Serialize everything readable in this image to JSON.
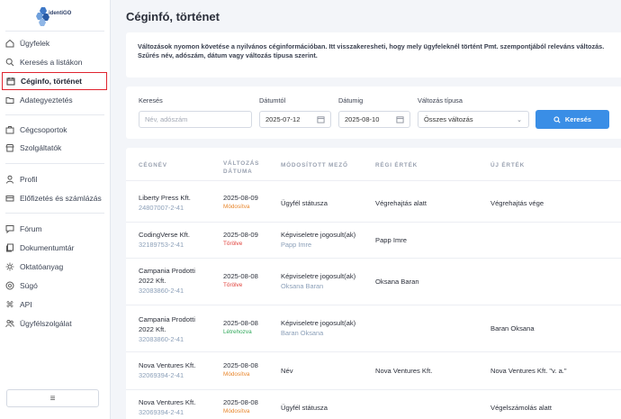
{
  "brand": {
    "logo_text": "identiGO"
  },
  "sidebar": {
    "items": [
      {
        "label": "Ügyfelek",
        "icon": "home-icon"
      },
      {
        "label": "Keresés a listákon",
        "icon": "search-icon"
      },
      {
        "label": "Céginfo, történet",
        "icon": "calendar-icon"
      },
      {
        "label": "Adategyeztetés",
        "icon": "folder-icon"
      },
      {
        "label": "Cégcsoportok",
        "icon": "briefcase-icon"
      },
      {
        "label": "Szolgáltatók",
        "icon": "store-icon"
      },
      {
        "label": "Profil",
        "icon": "user-icon"
      },
      {
        "label": "Előfizetés és számlázás",
        "icon": "card-icon"
      },
      {
        "label": "Fórum",
        "icon": "chat-icon"
      },
      {
        "label": "Dokumentumtár",
        "icon": "documents-icon"
      },
      {
        "label": "Oktatóanyag",
        "icon": "sun-icon"
      },
      {
        "label": "Súgó",
        "icon": "help-icon"
      },
      {
        "label": "API",
        "icon": "command-icon"
      },
      {
        "label": "Ügyfélszolgálat",
        "icon": "people-icon"
      }
    ],
    "collapse_glyph": "≡"
  },
  "page": {
    "title": "Céginfó, történet",
    "description": "Változások nyomon követése a nyilvános céginformációban. Itt visszakeresheti, hogy mely ügyfeleknél történt Pmt. szempontjából releváns változás. Szűrés név, adószám, dátum vagy változás típusa szerint."
  },
  "filters": {
    "search_label": "Keresés",
    "search_placeholder": "Név, adószám",
    "date_from_label": "Dátumtól",
    "date_from_value": "2025-07-12",
    "date_to_label": "Dátumig",
    "date_to_value": "2025-08-10",
    "type_label": "Változás típusa",
    "type_value": "Összes változás",
    "search_button": "Keresés"
  },
  "table": {
    "headers": {
      "company": "CÉGNÉV",
      "date_line1": "VÁLTOZÁS",
      "date_line2": "DÁTUMA",
      "field": "MÓDOSÍTOTT MEZŐ",
      "old": "RÉGI ÉRTÉK",
      "new": "ÚJ ÉRTÉK"
    },
    "rows": [
      {
        "name1": "Liberty Press Kft.",
        "name2": "",
        "tax": "24807007-2-41",
        "date": "2025-08-09",
        "status": "Módosítva",
        "field": "Ügyfél státusza",
        "field_sub": "",
        "old": "Végrehajtás alatt",
        "new": "Végrehajtás vége"
      },
      {
        "name1": "CodingVerse Kft.",
        "name2": "",
        "tax": "32189753-2-41",
        "date": "2025-08-09",
        "status": "Törölve",
        "field": "Képviseletre jogosult(ak)",
        "field_sub": "Papp Imre",
        "old": "Papp Imre",
        "new": ""
      },
      {
        "name1": "Campania Prodotti",
        "name2": "2022 Kft.",
        "tax": "32083860-2-41",
        "date": "2025-08-08",
        "status": "Törölve",
        "field": "Képviseletre jogosult(ak)",
        "field_sub": "Oksana Baran",
        "old": "Oksana Baran",
        "new": ""
      },
      {
        "name1": "Campania Prodotti",
        "name2": "2022 Kft.",
        "tax": "32083860-2-41",
        "date": "2025-08-08",
        "status": "Létrehozva",
        "field": "Képviseletre jogosult(ak)",
        "field_sub": "Baran Oksana",
        "old": "",
        "new": "Baran Oksana"
      },
      {
        "name1": "Nova Ventures Kft.",
        "name2": "",
        "tax": "32069394-2-41",
        "date": "2025-08-08",
        "status": "Módosítva",
        "field": "Név",
        "field_sub": "",
        "old": "Nova Ventures Kft.",
        "new": "Nova Ventures Kft. \"v. a.\""
      },
      {
        "name1": "Nova Ventures Kft.",
        "name2": "",
        "tax": "32069394-2-41",
        "date": "2025-08-08",
        "status": "Módosítva",
        "field": "Ügyfél státusza",
        "field_sub": "",
        "old": "",
        "new": "Végelszámolás alatt"
      }
    ]
  },
  "colors": {
    "modified": "#e8862c",
    "deleted": "#e0403a",
    "created": "#2fa85a",
    "accent": "#3a8ee6",
    "active_outline": "#e0242f"
  }
}
